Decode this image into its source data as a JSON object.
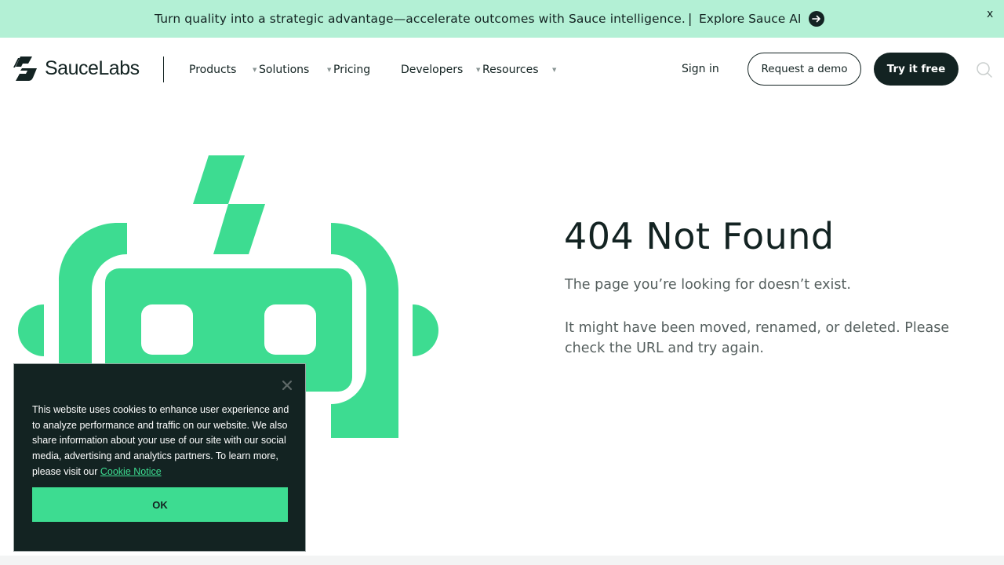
{
  "banner": {
    "text": "Turn quality into a strategic advantage—accelerate outcomes with Sauce intelligence.",
    "separator": "|",
    "link_label": "Explore Sauce AI",
    "arrow_icon": "arrow-right-icon",
    "close_label": "x"
  },
  "header": {
    "logo": {
      "part1": "Sauce",
      "part2": "Labs"
    },
    "nav": [
      {
        "label": "Products"
      },
      {
        "label": "Solutions"
      },
      {
        "label": "Pricing"
      },
      {
        "label": "Developers"
      },
      {
        "label": "Resources"
      }
    ],
    "sign_in": "Sign in",
    "demo": "Request a demo",
    "try": "Try it free",
    "search_icon": "search-icon"
  },
  "main": {
    "title": "404 Not Found",
    "p1": "The page you’re looking for doesn’t exist.",
    "p2": "It might have been moved, renamed, or deleted. Please check the URL and try again."
  },
  "cookie": {
    "text": "This website uses cookies to enhance user experience and to analyze performance and traffic on our website. We also share information about your use of our site with our social media, advertising and analytics partners. To learn more, please visit our",
    "link": "Cookie Notice",
    "ok": "OK"
  },
  "colors": {
    "brand_dark": "#132322",
    "brand_green": "#3ddc91",
    "banner_bg": "#b3f0d5"
  }
}
